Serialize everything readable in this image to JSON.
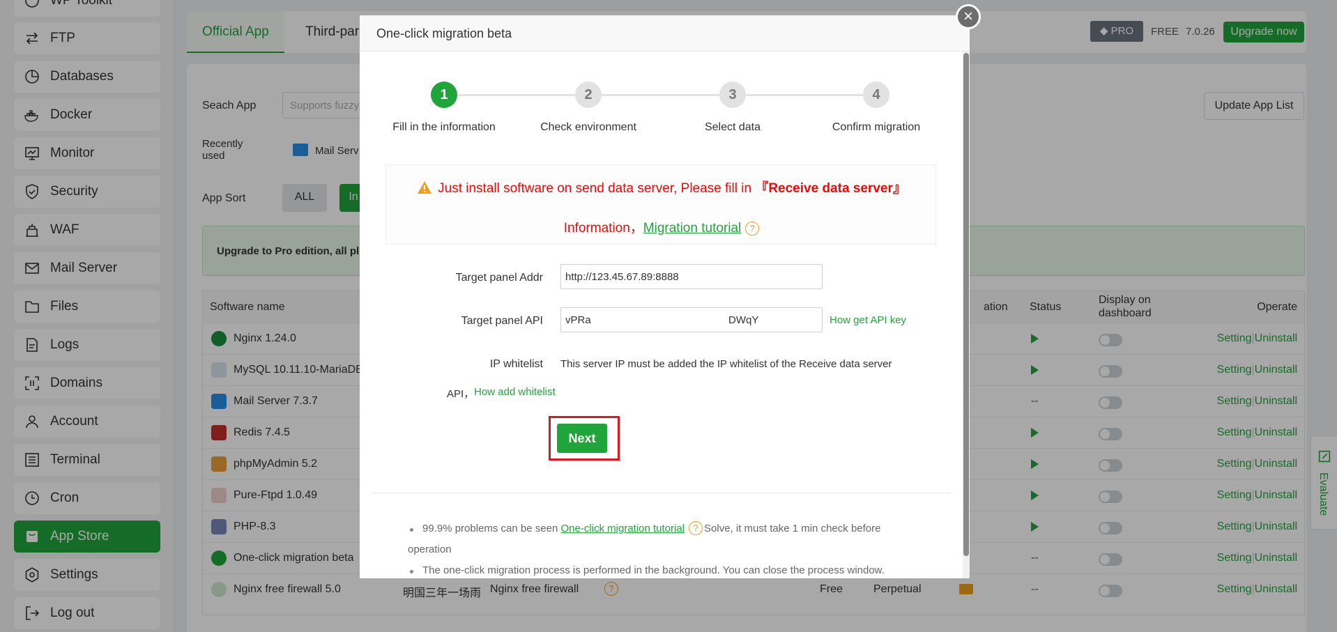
{
  "sidebar": {
    "items": [
      {
        "label": "WP Toolkit",
        "icon": "wordpress-icon"
      },
      {
        "label": "FTP",
        "icon": "ftp-icon"
      },
      {
        "label": "Databases",
        "icon": "database-icon"
      },
      {
        "label": "Docker",
        "icon": "docker-icon"
      },
      {
        "label": "Monitor",
        "icon": "monitor-icon"
      },
      {
        "label": "Security",
        "icon": "shield-icon"
      },
      {
        "label": "WAF",
        "icon": "firewall-icon"
      },
      {
        "label": "Mail Server",
        "icon": "mail-icon"
      },
      {
        "label": "Files",
        "icon": "folder-icon"
      },
      {
        "label": "Logs",
        "icon": "log-icon"
      },
      {
        "label": "Domains",
        "icon": "domain-icon"
      },
      {
        "label": "Account",
        "icon": "user-icon"
      },
      {
        "label": "Terminal",
        "icon": "terminal-icon"
      },
      {
        "label": "Cron",
        "icon": "clock-icon"
      },
      {
        "label": "App Store",
        "icon": "store-icon"
      },
      {
        "label": "Settings",
        "icon": "gear-icon"
      },
      {
        "label": "Log out",
        "icon": "logout-icon"
      }
    ]
  },
  "header": {
    "tabs": [
      "Official App",
      "Third-par"
    ],
    "pro_badge": "PRO",
    "free_label": "FREE",
    "version": "7.0.26",
    "upgrade_label": "Upgrade now"
  },
  "appstore": {
    "search_label": "Seach App",
    "search_placeholder": "Supports fuzzy",
    "recent_label": "Recently used",
    "recent_item": "Mail Serv",
    "sort_label": "App Sort",
    "sort_all": "ALL",
    "sort_second": "In",
    "update_button": "Update App List",
    "upgrade_notice": "Upgrade to Pro edition, all pl",
    "columns": {
      "name": "Software name",
      "location": "ation",
      "status": "Status",
      "display": "Display on dashboard",
      "operate": "Operate"
    },
    "rows": [
      {
        "name": "Nginx 1.24.0",
        "status": "running"
      },
      {
        "name": "MySQL 10.11.10-MariaDB",
        "status": "running"
      },
      {
        "name": "Mail Server 7.3.7",
        "status": "--"
      },
      {
        "name": "Redis 7.4.5",
        "status": "running"
      },
      {
        "name": "phpMyAdmin 5.2",
        "status": "running"
      },
      {
        "name": "Pure-Ftpd 1.0.49",
        "status": "running"
      },
      {
        "name": "PHP-8.3",
        "status": "running"
      },
      {
        "name": "One-click migration beta",
        "status": "--"
      },
      {
        "name": "Nginx free firewall 5.0",
        "status": "--",
        "developer": "明国三年一场雨",
        "description": "Nginx free firewall",
        "price": "Free",
        "expiry": "Perpetual"
      }
    ],
    "op_setting": "Setting",
    "op_uninstall": "Uninstall",
    "op_sep": "|",
    "status_dash": "--",
    "evaluate": "Evaluate"
  },
  "modal": {
    "title": "One-click migration beta",
    "close": "×",
    "steps": [
      {
        "num": "1",
        "label": "Fill in the information"
      },
      {
        "num": "2",
        "label": "Check environment"
      },
      {
        "num": "3",
        "label": "Select data"
      },
      {
        "num": "4",
        "label": "Confirm migration"
      }
    ],
    "warning_line1": "Just install software on send data server, Please fill in",
    "warning_bold": "『Receive data server』",
    "warning_line2": "Information，",
    "warning_link": "Migration tutorial",
    "help_mark": "?",
    "addr_label": "Target panel Addr",
    "addr_value": "http://123.45.67.89:8888",
    "api_label": "Target panel API",
    "api_value_start": "vPRa",
    "api_value_end": "DWqY",
    "api_help_link": "How get API key",
    "ip_label": "IP whitelist",
    "ip_text": "This server IP must be added the IP whitelist of the Receive data server",
    "ip_text2": "API，",
    "ip_link": "How add whitelist",
    "next": "Next",
    "note1_a": "99.9% problems can be seen",
    "note1_link": "One-click migration tutorial",
    "note1_b": "Solve, it must take 1 min check before",
    "note1_c": "operation",
    "note2": "The one-click migration process is performed in the background. You can close the process window."
  },
  "colors": {
    "accent": "#20a53a",
    "warning": "#ef0808",
    "highlight": "#e0151f"
  }
}
